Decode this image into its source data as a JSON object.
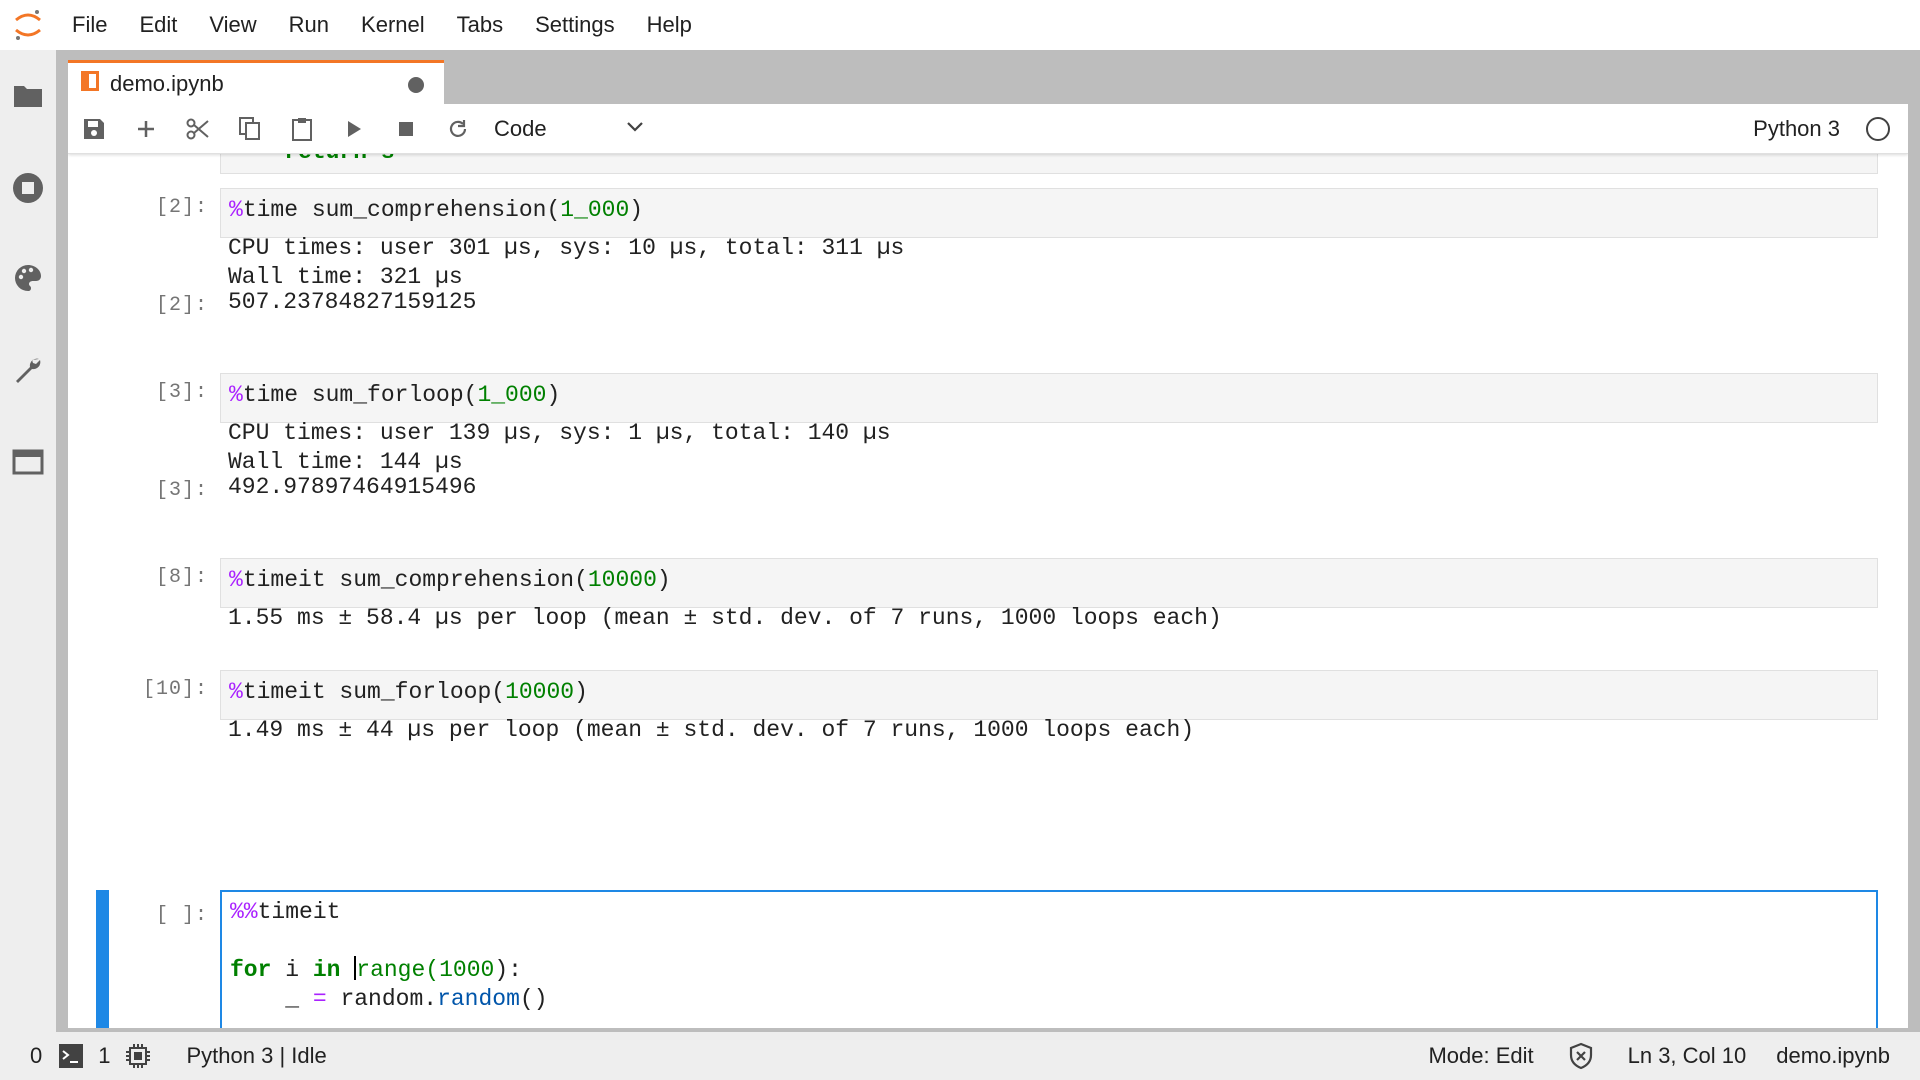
{
  "menu": [
    "File",
    "Edit",
    "View",
    "Run",
    "Kernel",
    "Tabs",
    "Settings",
    "Help"
  ],
  "tab": {
    "title": "demo.ipynb"
  },
  "toolbar": {
    "cell_type": "Code",
    "kernel_name": "Python 3"
  },
  "cells": {
    "partial": "    return s",
    "c2": {
      "prompt": "[2]:",
      "out_prompt": "[2]:",
      "magic": "%",
      "cmd": "time sum_comprehension(",
      "num": "1_000",
      "close": ")",
      "stdout1": "CPU times: user 301 µs, sys: 10 µs, total: 311 µs",
      "stdout2": "Wall time: 321 µs",
      "result": "507.23784827159125"
    },
    "c3": {
      "prompt": "[3]:",
      "out_prompt": "[3]:",
      "magic": "%",
      "cmd": "time sum_forloop(",
      "num": "1_000",
      "close": ")",
      "stdout1": "CPU times: user 139 µs, sys: 1 µs, total: 140 µs",
      "stdout2": "Wall time: 144 µs",
      "result": "492.97897464915496"
    },
    "c8": {
      "prompt": "[8]:",
      "magic": "%",
      "cmd": "timeit sum_comprehension(",
      "num": "10000",
      "close": ")",
      "stdout": "1.55 ms ± 58.4 µs per loop (mean ± std. dev. of 7 runs, 1000 loops each)"
    },
    "c10": {
      "prompt": "[10]:",
      "magic": "%",
      "cmd": "timeit sum_forloop(",
      "num": "10000",
      "close": ")",
      "stdout": "1.49 ms ± 44 µs per loop (mean ± std. dev. of 7 runs, 1000 loops each)"
    },
    "active": {
      "prompt": "[ ]:",
      "magic": "%%",
      "magic_name": "timeit",
      "kw_for": "for",
      "var": " i ",
      "kw_in": "in",
      "range_fn": "range(",
      "range_num": "1000",
      "range_close": "):",
      "indent": "    ",
      "underscore": "_",
      "assign": " = ",
      "obj": "random.",
      "method": "random",
      "call": "()"
    }
  },
  "status": {
    "terminals": "0",
    "kernels": "1",
    "kernel_state": "Python 3 | Idle",
    "mode": "Mode: Edit",
    "position": "Ln 3, Col 10",
    "file": "demo.ipynb"
  },
  "colors": {
    "accent": "#1e88e5",
    "tab_accent": "#f37626",
    "magic": "#aa22ff",
    "number": "#008000"
  }
}
